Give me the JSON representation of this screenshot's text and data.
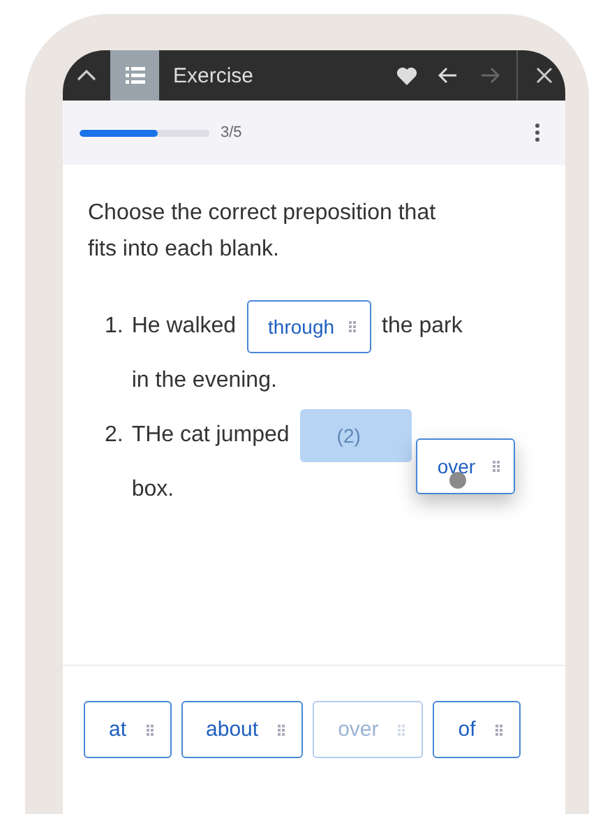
{
  "header": {
    "title": "Exercise",
    "list_active": true,
    "forward_disabled": true
  },
  "progress": {
    "level": 0.6,
    "label": "3/5"
  },
  "instruction": "Choose the correct preposition that fits into each blank.",
  "questions": [
    {
      "number": "1.",
      "before": "He walked",
      "blank": {
        "value": "through",
        "highlighted": false
      },
      "after": "the park",
      "continuation": "in the evening."
    },
    {
      "number": "2.",
      "before": "THe cat jumped",
      "blank": {
        "placeholder": "(2)",
        "highlighted": true
      },
      "continuation": "box."
    }
  ],
  "dragging": {
    "label": "over"
  },
  "word_bank": [
    {
      "label": "at",
      "used": false
    },
    {
      "label": "about",
      "used": false
    },
    {
      "label": "over",
      "used": true
    },
    {
      "label": "of",
      "used": false
    }
  ]
}
